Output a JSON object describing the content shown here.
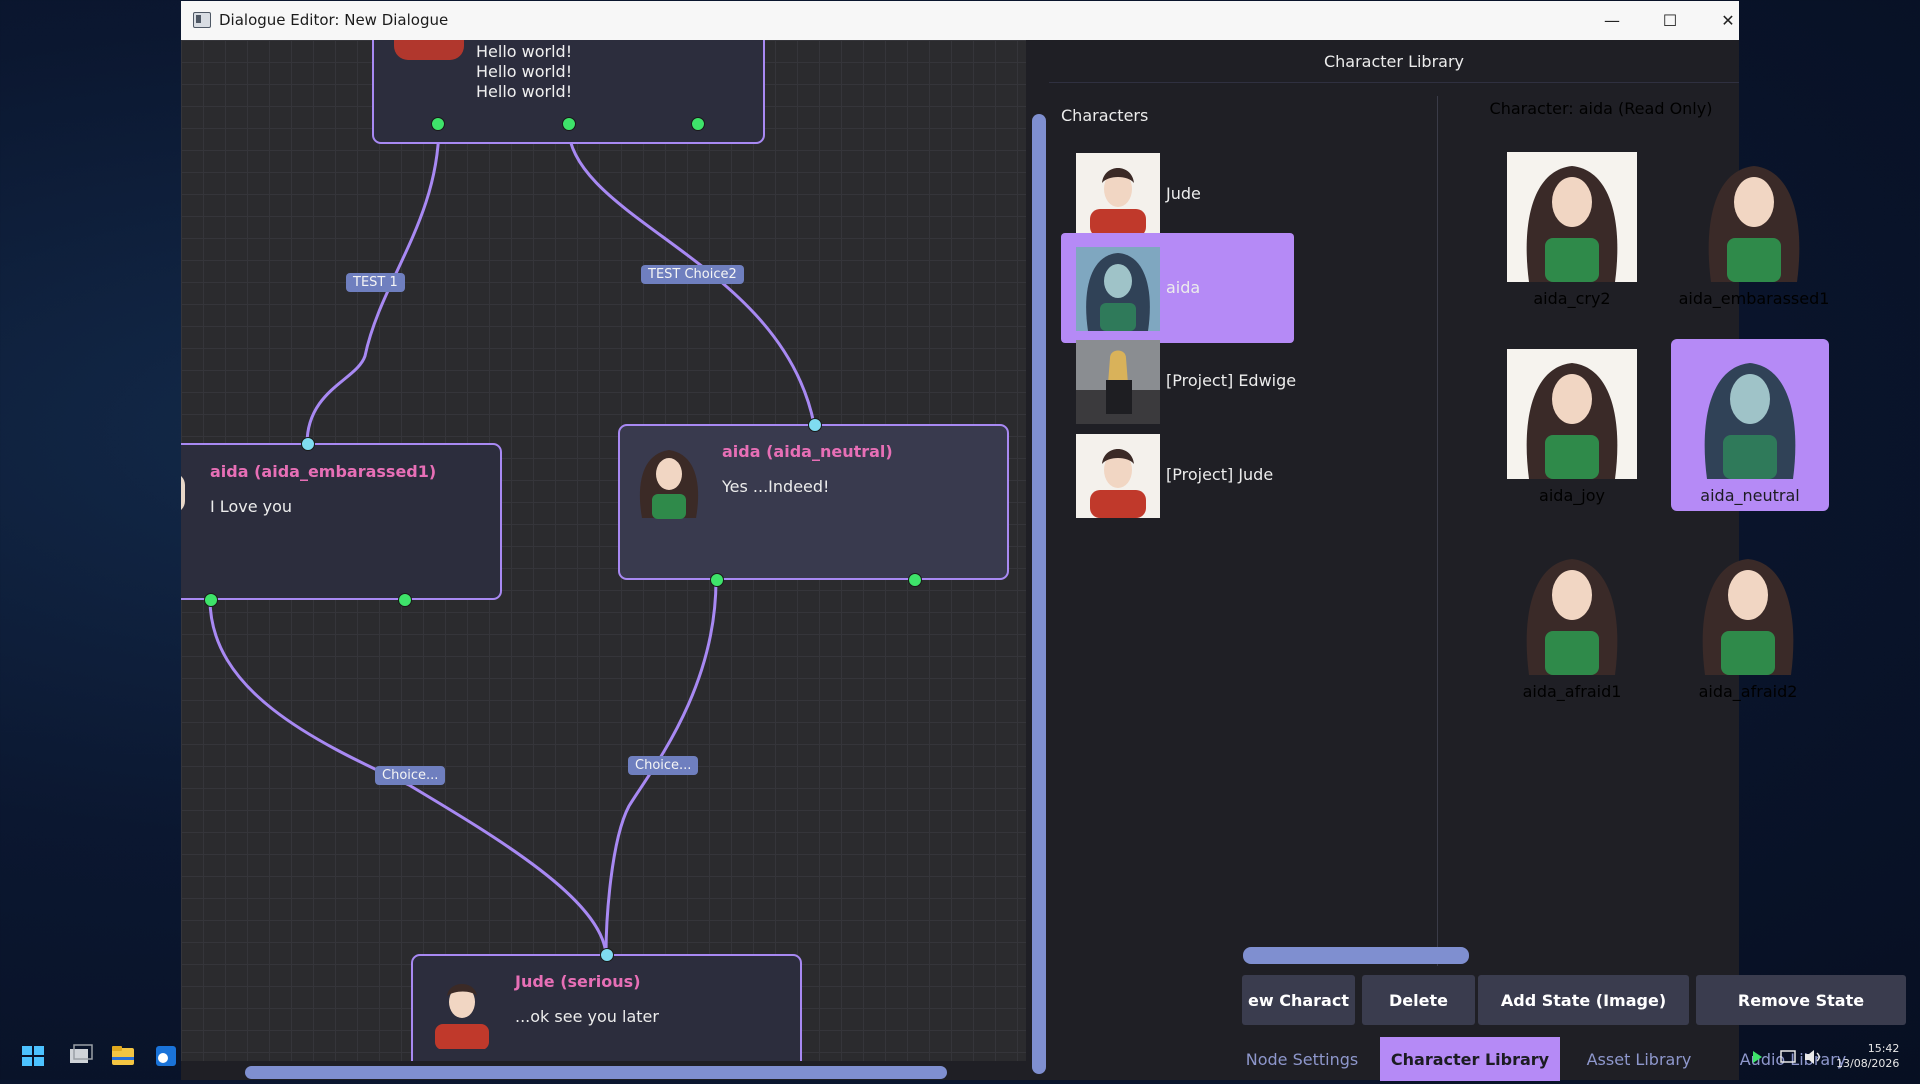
{
  "window": {
    "title": "Dialogue Editor: New Dialogue",
    "minimize": "—",
    "maximize": "☐",
    "close": "✕"
  },
  "canvas": {
    "nodes": [
      {
        "title": "",
        "text": "Hello world!\nHello world!\nHello world!"
      },
      {
        "title": "aida (aida_embarassed1)",
        "text": "I Love you"
      },
      {
        "title": "aida (aida_neutral)",
        "text": "Yes ...Indeed!"
      },
      {
        "title": "Jude (serious)",
        "text": "...ok see you later"
      }
    ],
    "edge_labels": [
      "TEST 1",
      "TEST Choice2",
      "Choice...",
      "Choice..."
    ]
  },
  "panel": {
    "header": "Character Library",
    "characters_header": "Characters",
    "characters": [
      {
        "name": "Jude",
        "selected": false
      },
      {
        "name": "aida",
        "selected": true
      },
      {
        "name": "[Project] Edwige",
        "selected": false
      },
      {
        "name": "[Project] Jude",
        "selected": false
      }
    ],
    "detail_header": "Character: aida (Read Only)",
    "states": [
      {
        "name": "aida_cry2",
        "selected": false
      },
      {
        "name": "aida_embarassed1",
        "selected": false
      },
      {
        "name": "aida_joy",
        "selected": false
      },
      {
        "name": "aida_neutral",
        "selected": true
      },
      {
        "name": "aida_afraid1",
        "selected": false
      },
      {
        "name": "aida_afraid2",
        "selected": false
      }
    ],
    "buttons": {
      "new_character": "ew Charact",
      "delete": "Delete",
      "add_state": "Add State (Image)",
      "remove_state": "Remove State"
    },
    "tabs": [
      {
        "label": "Node Settings",
        "active": false
      },
      {
        "label": "Character Library",
        "active": true
      },
      {
        "label": "Asset Library",
        "active": false
      },
      {
        "label": "Audio Library",
        "active": false
      }
    ]
  },
  "taskbar": {
    "time": "15:42",
    "date": "13/08/2026"
  },
  "colors": {
    "accent": "#b58af6",
    "node_title": "#e76fb6",
    "edge": "#a889f3",
    "pin_output": "#3ee36a",
    "pin_input": "#7fdcf0",
    "scrollbar": "#7f8fd0"
  }
}
